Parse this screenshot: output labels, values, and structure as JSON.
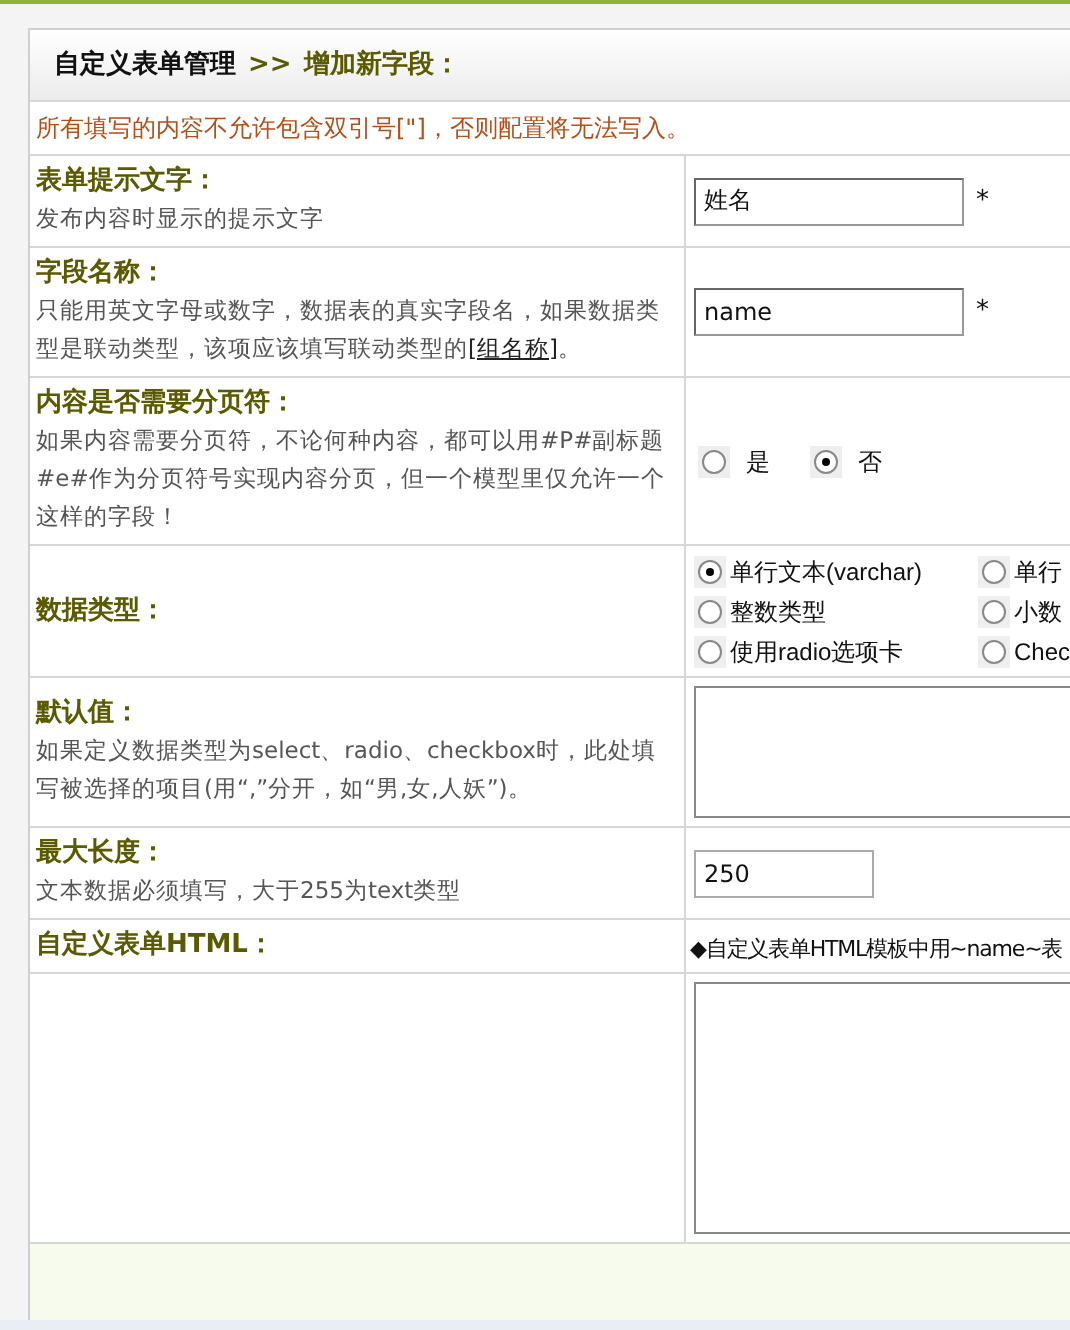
{
  "breadcrumb": {
    "root": "自定义表单管理",
    "separator": ">>",
    "current": "增加新字段："
  },
  "notice": "所有填写的内容不允许包含双引号[\"]，否则配置将无法写入。",
  "fields": [
    {
      "kind": "text",
      "label": "表单提示文字：",
      "description": "发布内容时显示的提示文字",
      "value": "姓名",
      "required_mark": "*"
    },
    {
      "kind": "text",
      "label": "字段名称：",
      "description": "只能用英文字母或数字，数据表的真实字段名，如果数据类型是联动类型，该项应该填写联动类型的",
      "link": "[组名称]",
      "description_end": "。",
      "value": "name",
      "required_mark": "*"
    },
    {
      "kind": "radio",
      "label": "内容是否需要分页符：",
      "description": "如果内容需要分页符，不论何种内容，都可以用#P#副标题#e#作为分页符号实现内容分页，但一个模型里仅允许一个这样的字段！",
      "options": [
        {
          "label": "是",
          "selected": false
        },
        {
          "label": "否",
          "selected": true
        }
      ]
    },
    {
      "kind": "radio_grid",
      "label": "数据类型：",
      "options": [
        {
          "label": "单行文本(varchar)",
          "selected": true
        },
        {
          "label": "单行",
          "selected": false
        },
        {
          "label": "整数类型",
          "selected": false
        },
        {
          "label": "小数",
          "selected": false
        },
        {
          "label": "使用radio选项卡",
          "selected": false
        },
        {
          "label": "Chec",
          "selected": false
        }
      ]
    },
    {
      "kind": "textarea",
      "label": "默认值：",
      "description": "如果定义数据类型为select、radio、checkbox时，此处填写被选择的项目(用“,”分开，如“男,女,人妖”)。"
    },
    {
      "kind": "short_text",
      "label": "最大长度：",
      "description": "文本数据必须填写，大于255为text类型",
      "value": "250"
    },
    {
      "kind": "note",
      "label": "自定义表单HTML：",
      "note": "◆自定义表单HTML模板中用~name~表"
    },
    {
      "kind": "big_textarea"
    }
  ]
}
